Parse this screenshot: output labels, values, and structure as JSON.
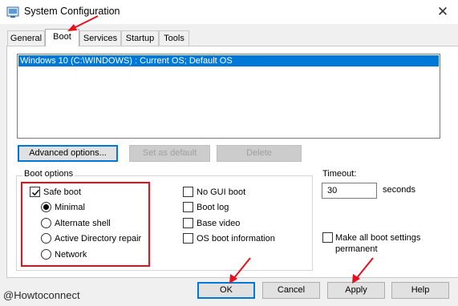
{
  "window": {
    "title": "System Configuration"
  },
  "tabs": [
    {
      "label": "General"
    },
    {
      "label": "Boot"
    },
    {
      "label": "Services"
    },
    {
      "label": "Startup"
    },
    {
      "label": "Tools"
    }
  ],
  "os_list": {
    "items": [
      "Windows 10 (C:\\WINDOWS) : Current OS; Default OS"
    ]
  },
  "list_buttons": {
    "advanced": "Advanced options...",
    "set_default": "Set as default",
    "delete": "Delete"
  },
  "boot_options": {
    "group_label": "Boot options",
    "safe_boot": {
      "label": "Safe boot",
      "checked": true
    },
    "safe_boot_modes": [
      {
        "label": "Minimal",
        "selected": true
      },
      {
        "label": "Alternate shell",
        "selected": false
      },
      {
        "label": "Active Directory repair",
        "selected": false
      },
      {
        "label": "Network",
        "selected": false
      }
    ],
    "flags": [
      {
        "label": "No GUI boot",
        "checked": false
      },
      {
        "label": "Boot log",
        "checked": false
      },
      {
        "label": "Base video",
        "checked": false
      },
      {
        "label": "OS boot information",
        "checked": false
      }
    ]
  },
  "timeout": {
    "label": "Timeout:",
    "value": "30",
    "unit": "seconds"
  },
  "make_permanent": {
    "label": "Make all boot settings permanent",
    "checked": false
  },
  "dialog_buttons": {
    "ok": "OK",
    "cancel": "Cancel",
    "apply": "Apply",
    "help": "Help"
  },
  "watermark": "@Howtoconnect",
  "colors": {
    "selection": "#0078d7",
    "annotation": "#e8101d",
    "dialog_background": "#f0f0f0"
  }
}
